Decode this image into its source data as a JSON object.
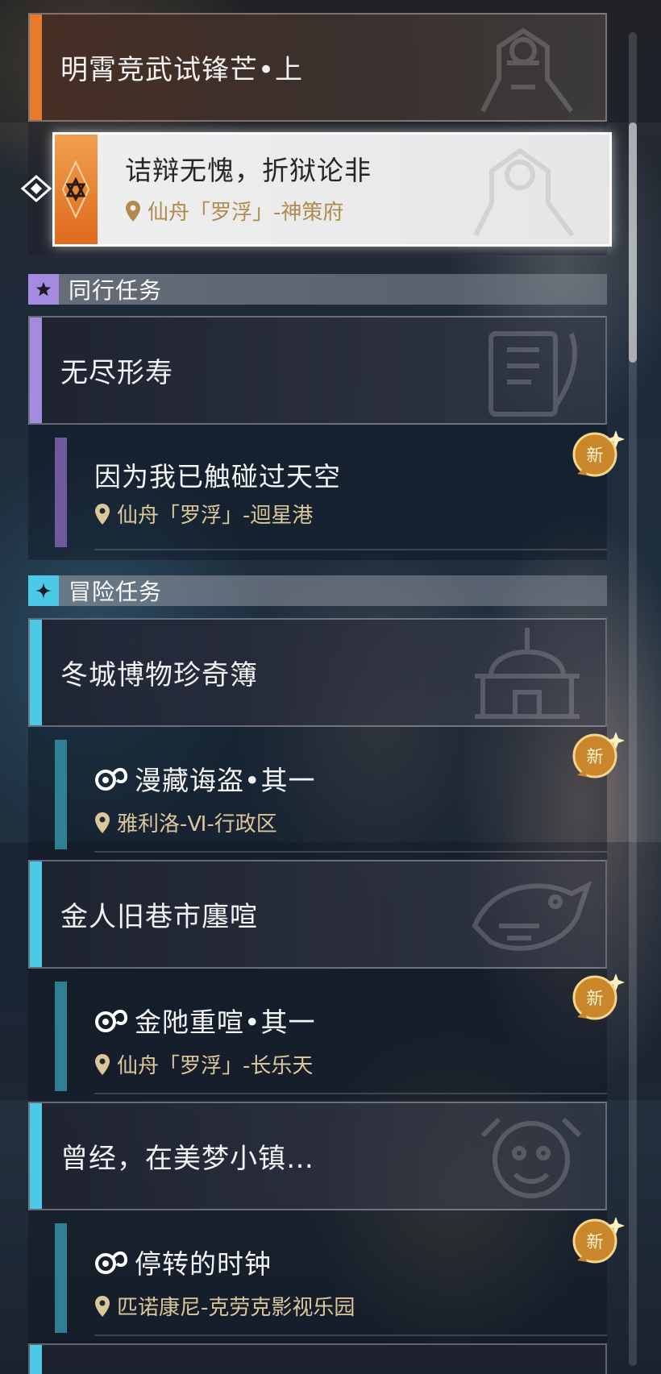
{
  "colors": {
    "orange_accent": "#e87a2c",
    "purple_accent": "#a58be0",
    "cyan_accent": "#4cc9e6",
    "location_gold": "#dcc79a",
    "new_badge": "#c9862a"
  },
  "trailblaze": {
    "group_title": "明霄竞武试锋芒•上",
    "selected_quest": {
      "title": "诘辩无愧，折狱论非",
      "location": "仙舟「罗浮」-神策府"
    }
  },
  "sections": {
    "companion": {
      "label": "同行任务",
      "icon": "star-icon",
      "group_title": "无尽形寿",
      "quest": {
        "title": "因为我已触碰过天空",
        "location": "仙舟「罗浮」-迴星港",
        "badge": "新"
      }
    },
    "adventure": {
      "label": "冒险任务",
      "icon": "sparkle-icon",
      "groups": [
        {
          "group_title": "冬城博物珍奇簿",
          "quest": {
            "title": "漫藏诲盗•其一",
            "location": "雅利洛-Ⅵ-行政区",
            "badge": "新"
          }
        },
        {
          "group_title": "金人旧巷市廛喧",
          "quest": {
            "title": "金阤重喧•其一",
            "location": "仙舟「罗浮」-长乐天",
            "badge": "新"
          }
        },
        {
          "group_title": "曾经，在美梦小镇…",
          "quest": {
            "title": "停转的时钟",
            "location": "匹诺康尼-克劳克影视乐园",
            "badge": "新"
          }
        }
      ]
    }
  }
}
